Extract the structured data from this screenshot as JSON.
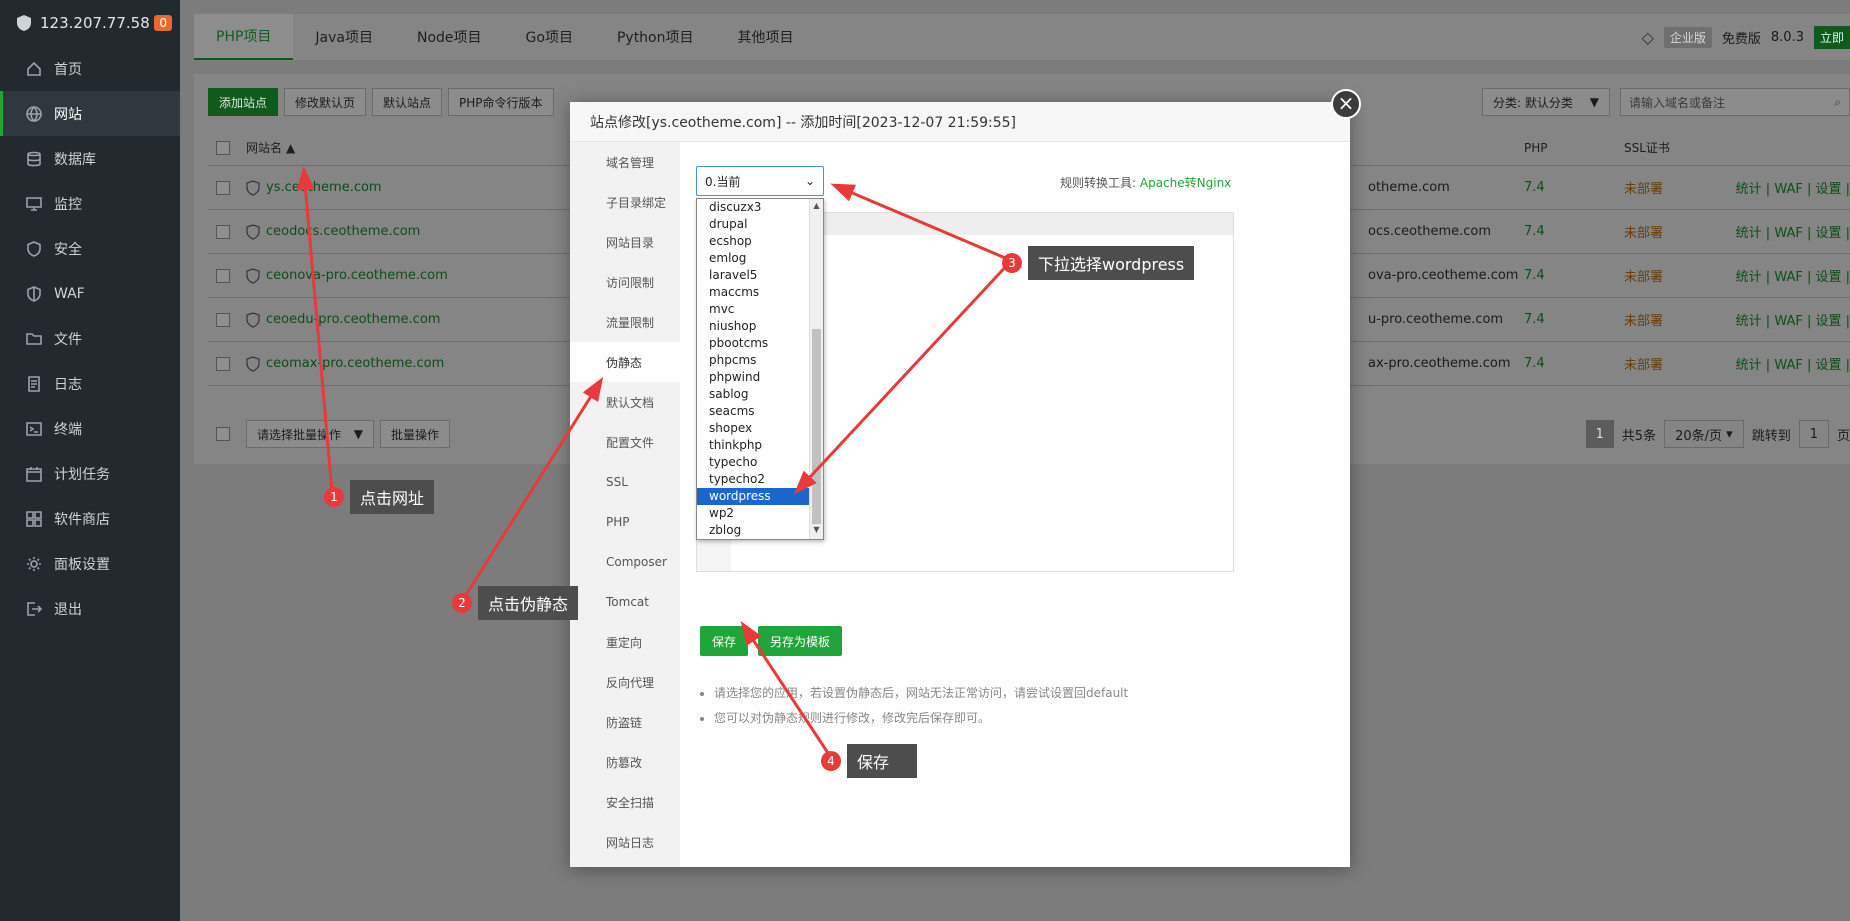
{
  "sidebar": {
    "ip": "123.207.77.58",
    "badge": "0",
    "items": [
      {
        "label": "首页",
        "icon": "home-icon"
      },
      {
        "label": "网站",
        "icon": "globe-icon"
      },
      {
        "label": "数据库",
        "icon": "database-icon"
      },
      {
        "label": "监控",
        "icon": "monitor-icon"
      },
      {
        "label": "安全",
        "icon": "shield-icon"
      },
      {
        "label": "WAF",
        "icon": "waf-shield-icon"
      },
      {
        "label": "文件",
        "icon": "folder-icon"
      },
      {
        "label": "日志",
        "icon": "log-icon"
      },
      {
        "label": "终端",
        "icon": "terminal-icon"
      },
      {
        "label": "计划任务",
        "icon": "calendar-icon"
      },
      {
        "label": "软件商店",
        "icon": "grid-icon"
      },
      {
        "label": "面板设置",
        "icon": "settings-icon"
      },
      {
        "label": "退出",
        "icon": "logout-icon"
      }
    ]
  },
  "topbar": {
    "tabs": [
      "PHP项目",
      "Java项目",
      "Node项目",
      "Go项目",
      "Python项目",
      "其他项目"
    ],
    "edition": "企业版",
    "free": "免费版",
    "version": "8.0.3",
    "upgrade": "立即"
  },
  "toolbar": {
    "buttons": [
      "添加站点",
      "修改默认页",
      "默认站点",
      "PHP命令行版本"
    ],
    "category": "分类: 默认分类",
    "search_placeholder": "请输入域名或备注"
  },
  "table": {
    "headers": {
      "name": "网站名",
      "php": "PHP",
      "ssl": "SSL证书"
    },
    "rows": [
      {
        "name": "ys.ceotheme.com",
        "domain": "otheme.com",
        "php": "7.4",
        "ssl": "未部署"
      },
      {
        "name": "ceodocs.ceotheme.com",
        "domain": "ocs.ceotheme.com",
        "php": "7.4",
        "ssl": "未部署"
      },
      {
        "name": "ceonova-pro.ceotheme.com",
        "domain": "ova-pro.ceotheme.com",
        "php": "7.4",
        "ssl": "未部署"
      },
      {
        "name": "ceoedu-pro.ceotheme.com",
        "domain": "u-pro.ceotheme.com",
        "php": "7.4",
        "ssl": "未部署"
      },
      {
        "name": "ceomax-pro.ceotheme.com",
        "domain": "ax-pro.ceotheme.com",
        "php": "7.4",
        "ssl": "未部署"
      }
    ],
    "ops": "统计 | WAF | 设置 |",
    "batch_select": "请选择批量操作",
    "batch_btn": "批量操作",
    "pager": {
      "page": "1",
      "total": "共5条",
      "per": "20条/页",
      "jump": "跳转到",
      "jump_val": "1",
      "unit": "页"
    }
  },
  "modal": {
    "title": "站点修改[ys.ceotheme.com] -- 添加时间[2023-12-07 21:59:55]",
    "menu": [
      "域名管理",
      "子目录绑定",
      "网站目录",
      "访问限制",
      "流量限制",
      "伪静态",
      "默认文档",
      "配置文件",
      "SSL",
      "PHP",
      "Composer",
      "Tomcat",
      "重定向",
      "反向代理",
      "防盗链",
      "防篡改",
      "安全扫描",
      "网站日志"
    ],
    "active_menu": "伪静态",
    "rule_select": "0.当前",
    "convert_label": "规则转换工具:",
    "convert_link": "Apache转Nginx",
    "options": [
      "discuzx3",
      "drupal",
      "ecshop",
      "emlog",
      "laravel5",
      "maccms",
      "mvc",
      "niushop",
      "pbootcms",
      "phpcms",
      "phpwind",
      "sablog",
      "seacms",
      "shopex",
      "thinkphp",
      "typecho",
      "typecho2",
      "wordpress",
      "wp2",
      "zblog"
    ],
    "selected_option": "wordpress",
    "save": "保存",
    "save_template": "另存为模板",
    "tips": [
      "请选择您的应用，若设置伪静态后，网站无法正常访问，请尝试设置回default",
      "您可以对伪静态规则进行修改，修改完后保存即可。"
    ]
  },
  "annotations": [
    {
      "num": "1",
      "label": "点击网址"
    },
    {
      "num": "2",
      "label": "点击伪静态"
    },
    {
      "num": "3",
      "label": "下拉选择wordpress"
    },
    {
      "num": "4",
      "label": "保存"
    }
  ],
  "colors": {
    "accent": "#20a53a",
    "annotation_red": "#e8393b",
    "selected": "#1a66cc"
  }
}
